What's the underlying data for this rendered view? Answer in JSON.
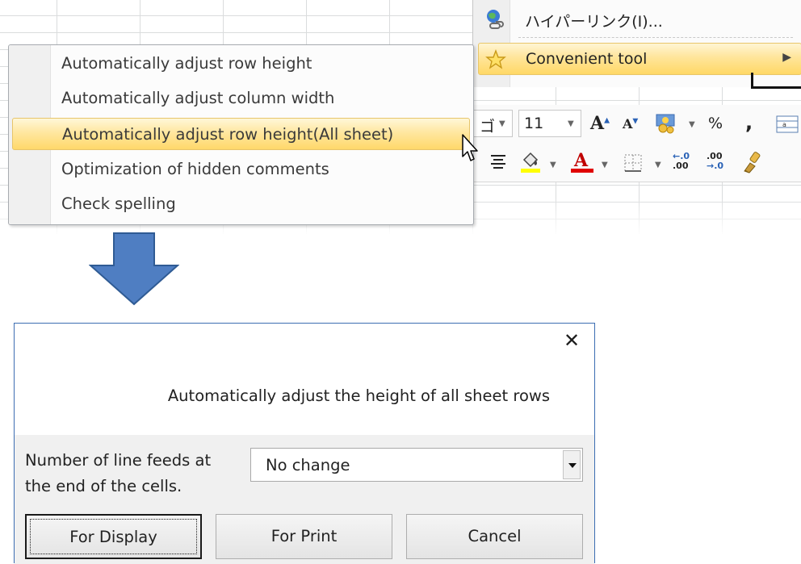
{
  "context_menu": {
    "hyperlink_label": "ハイパーリンク(I)...",
    "convenient_tool_label": "Convenient tool",
    "submenu_arrow": "▶"
  },
  "mini_toolbar": {
    "font_name_fragment": "ゴ",
    "font_size": "11",
    "grow_font_glyph": "A",
    "shrink_font_glyph": "A",
    "percent_label": "%",
    "comma_label": ",",
    "font_color_glyph": "A",
    "increase_decimal_top": "←.0",
    "increase_decimal_bottom": ".00",
    "decrease_decimal_top": ".00",
    "decrease_decimal_bottom": "→.0"
  },
  "submenu": {
    "items": [
      {
        "label": "Automatically adjust row height"
      },
      {
        "label": "Automatically adjust column width"
      },
      {
        "label": "Automatically adjust row height(All sheet)"
      },
      {
        "label": "Optimization of hidden comments"
      },
      {
        "label": "Check spelling"
      }
    ],
    "highlighted_index": 2
  },
  "dialog": {
    "close_glyph": "✕",
    "message": "Automatically adjust the height of all sheet rows",
    "line_feeds_label_1": "Number of line feeds at",
    "line_feeds_label_2": "the end of the cells.",
    "line_feeds_value": "No change",
    "buttons": {
      "display": "For Display",
      "print": "For Print",
      "cancel": "Cancel"
    }
  },
  "colors": {
    "highlight_top": "#fff7d8",
    "highlight_bottom": "#ffd86a",
    "arrow_fill": "#4f7ec2",
    "arrow_stroke": "#2f5b94",
    "dialog_border": "#3c6db2",
    "dialog_body": "#f0f0f0"
  }
}
